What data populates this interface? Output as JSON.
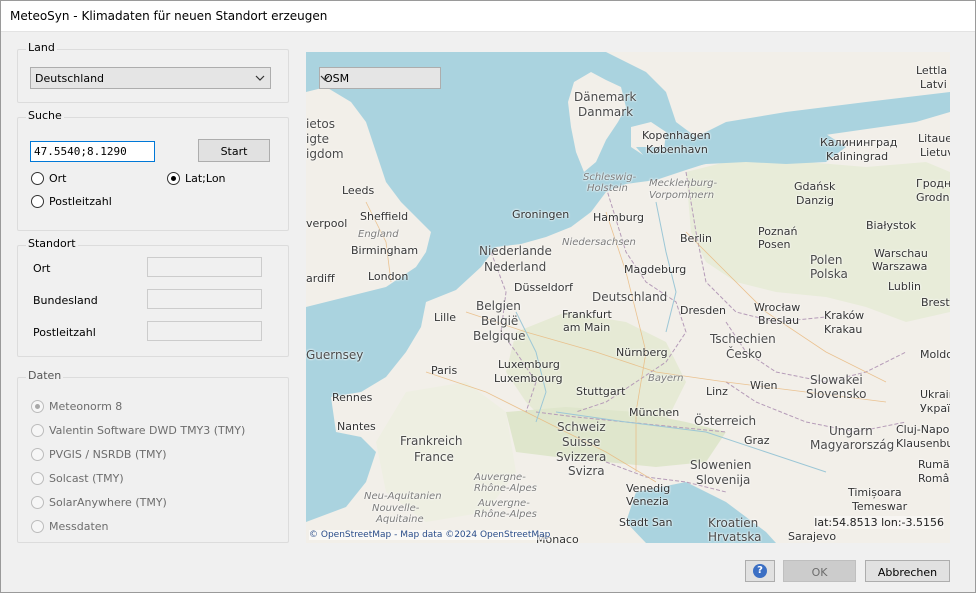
{
  "window": {
    "title": "MeteoSyn - Klimadaten für neuen Standort erzeugen"
  },
  "land": {
    "legend": "Land",
    "selected": "Deutschland"
  },
  "suche": {
    "legend": "Suche",
    "input_value": "47.5540;8.1290",
    "start_label": "Start",
    "options": [
      {
        "label": "Ort",
        "checked": false
      },
      {
        "label": "Lat;Lon",
        "checked": true
      },
      {
        "label": "Postleitzahl",
        "checked": false
      }
    ]
  },
  "standort": {
    "legend": "Standort",
    "fields": [
      {
        "label": "Ort",
        "value": ""
      },
      {
        "label": "Bundesland",
        "value": ""
      },
      {
        "label": "Postleitzahl",
        "value": ""
      }
    ]
  },
  "daten": {
    "legend": "Daten",
    "options": [
      {
        "label": "Meteonorm 8",
        "checked": true
      },
      {
        "label": "Valentin Software DWD TMY3 (TMY)",
        "checked": false
      },
      {
        "label": "PVGIS / NSRDB (TMY)",
        "checked": false
      },
      {
        "label": "Solcast (TMY)",
        "checked": false
      },
      {
        "label": "SolarAnywhere (TMY)",
        "checked": false
      },
      {
        "label": "Messdaten",
        "checked": false
      }
    ]
  },
  "map": {
    "layer": "OSM",
    "attribution": "© OpenStreetMap - Map data ©2024 OpenStreetMap",
    "coords": "lat:54.8513  lon:-3.5156",
    "labels": [
      {
        "text": "Danmark",
        "cls": "big"
      },
      {
        "text": "Dänemark",
        "cls": "big"
      },
      {
        "text": "Kopenhagen",
        "cls": ""
      },
      {
        "text": "København",
        "cls": ""
      },
      {
        "text": "Калининград",
        "cls": ""
      },
      {
        "text": "Kaliningrad",
        "cls": ""
      },
      {
        "text": "Gdańsk",
        "cls": ""
      },
      {
        "text": "Danzig",
        "cls": ""
      },
      {
        "text": "Schleswig-",
        "cls": "region"
      },
      {
        "text": "Holstein",
        "cls": "region"
      },
      {
        "text": "Mecklenburg-",
        "cls": "region"
      },
      {
        "text": "Vorpommern",
        "cls": "region"
      },
      {
        "text": "Hamburg",
        "cls": ""
      },
      {
        "text": "Groningen",
        "cls": ""
      },
      {
        "text": "Niedersachsen",
        "cls": "region"
      },
      {
        "text": "Berlin",
        "cls": ""
      },
      {
        "text": "Poznań",
        "cls": ""
      },
      {
        "text": "Posen",
        "cls": ""
      },
      {
        "text": "Białystok",
        "cls": ""
      },
      {
        "text": "Warschau",
        "cls": ""
      },
      {
        "text": "Warszawa",
        "cls": ""
      },
      {
        "text": "Polen",
        "cls": "big"
      },
      {
        "text": "Polska",
        "cls": "big"
      },
      {
        "text": "Lublin",
        "cls": ""
      },
      {
        "text": "Niederlande",
        "cls": "big"
      },
      {
        "text": "Nederland",
        "cls": "big"
      },
      {
        "text": "Magdeburg",
        "cls": ""
      },
      {
        "text": "Düsseldorf",
        "cls": ""
      },
      {
        "text": "Deutschland",
        "cls": "big"
      },
      {
        "text": "Dresden",
        "cls": ""
      },
      {
        "text": "Wrocław",
        "cls": ""
      },
      {
        "text": "Breslau",
        "cls": ""
      },
      {
        "text": "Kraków",
        "cls": ""
      },
      {
        "text": "Krakau",
        "cls": ""
      },
      {
        "text": "Belgien",
        "cls": "big"
      },
      {
        "text": "België",
        "cls": "big"
      },
      {
        "text": "Belgique",
        "cls": "big"
      },
      {
        "text": "Lille",
        "cls": ""
      },
      {
        "text": "Frankfurt",
        "cls": ""
      },
      {
        "text": "am Main",
        "cls": ""
      },
      {
        "text": "Tschechien",
        "cls": "big"
      },
      {
        "text": "Česko",
        "cls": "big"
      },
      {
        "text": "Luxemburg",
        "cls": ""
      },
      {
        "text": "Luxembourg",
        "cls": ""
      },
      {
        "text": "Nürnberg",
        "cls": ""
      },
      {
        "text": "Bayern",
        "cls": "region"
      },
      {
        "text": "Paris",
        "cls": ""
      },
      {
        "text": "Stuttgart",
        "cls": ""
      },
      {
        "text": "Linz",
        "cls": ""
      },
      {
        "text": "Wien",
        "cls": ""
      },
      {
        "text": "Slowakei",
        "cls": "big"
      },
      {
        "text": "Slovensko",
        "cls": "big"
      },
      {
        "text": "Rennes",
        "cls": ""
      },
      {
        "text": "München",
        "cls": ""
      },
      {
        "text": "Schweiz",
        "cls": "big"
      },
      {
        "text": "Suisse",
        "cls": "big"
      },
      {
        "text": "Svizzera",
        "cls": "big"
      },
      {
        "text": "Svizra",
        "cls": "big"
      },
      {
        "text": "Österreich",
        "cls": "big"
      },
      {
        "text": "Ungarn",
        "cls": "big"
      },
      {
        "text": "Magyarország",
        "cls": "big"
      },
      {
        "text": "Nantes",
        "cls": ""
      },
      {
        "text": "Frankreich",
        "cls": "big"
      },
      {
        "text": "France",
        "cls": "big"
      },
      {
        "text": "Graz",
        "cls": ""
      },
      {
        "text": "Slowenien",
        "cls": "big"
      },
      {
        "text": "Slovenija",
        "cls": "big"
      },
      {
        "text": "Auvergne-",
        "cls": "region"
      },
      {
        "text": "Rhône-Alpes",
        "cls": "region"
      },
      {
        "text": "Auvergne-",
        "cls": "region"
      },
      {
        "text": "Rhône-Alpes",
        "cls": "region"
      },
      {
        "text": "Neu-Aquitanien",
        "cls": "region"
      },
      {
        "text": "Nouvelle-",
        "cls": "region"
      },
      {
        "text": "Aquitaine",
        "cls": "region"
      },
      {
        "text": "Venedig",
        "cls": ""
      },
      {
        "text": "Venezia",
        "cls": ""
      },
      {
        "text": "Stadt San",
        "cls": ""
      },
      {
        "text": "Kroatien",
        "cls": "big"
      },
      {
        "text": "Hrvatska",
        "cls": "big"
      },
      {
        "text": "Monaco",
        "cls": ""
      },
      {
        "text": "Sarajevo",
        "cls": ""
      },
      {
        "text": "Timișoara",
        "cls": ""
      },
      {
        "text": "Temeswar",
        "cls": ""
      },
      {
        "text": "Cluj-Napoca",
        "cls": ""
      },
      {
        "text": "Klausenburg",
        "cls": ""
      },
      {
        "text": "Leeds",
        "cls": ""
      },
      {
        "text": "Sheffield",
        "cls": ""
      },
      {
        "text": "England",
        "cls": "region"
      },
      {
        "text": "Birmingham",
        "cls": ""
      },
      {
        "text": "London",
        "cls": ""
      },
      {
        "text": "Guernsey",
        "cls": "big"
      },
      {
        "text": "verpool",
        "cls": ""
      },
      {
        "text": "ardiff",
        "cls": ""
      },
      {
        "text": "igdom",
        "cls": "big"
      },
      {
        "text": "ietos",
        "cls": "big"
      },
      {
        "text": "igte",
        "cls": "big"
      },
      {
        "text": "Lettla",
        "cls": ""
      },
      {
        "text": "Latvi",
        "cls": ""
      },
      {
        "text": "Litaue",
        "cls": ""
      },
      {
        "text": "Lietuv",
        "cls": ""
      },
      {
        "text": "Гродна",
        "cls": ""
      },
      {
        "text": "Grodno",
        "cls": ""
      },
      {
        "text": "Brest",
        "cls": ""
      },
      {
        "text": "Moldo",
        "cls": ""
      },
      {
        "text": "Rumäni",
        "cls": ""
      },
      {
        "text": "România",
        "cls": ""
      },
      {
        "text": "Ukrain",
        "cls": ""
      },
      {
        "text": "Україна",
        "cls": ""
      }
    ]
  },
  "buttons": {
    "help_symbol": "?",
    "ok": "OK",
    "cancel": "Abbrechen"
  }
}
